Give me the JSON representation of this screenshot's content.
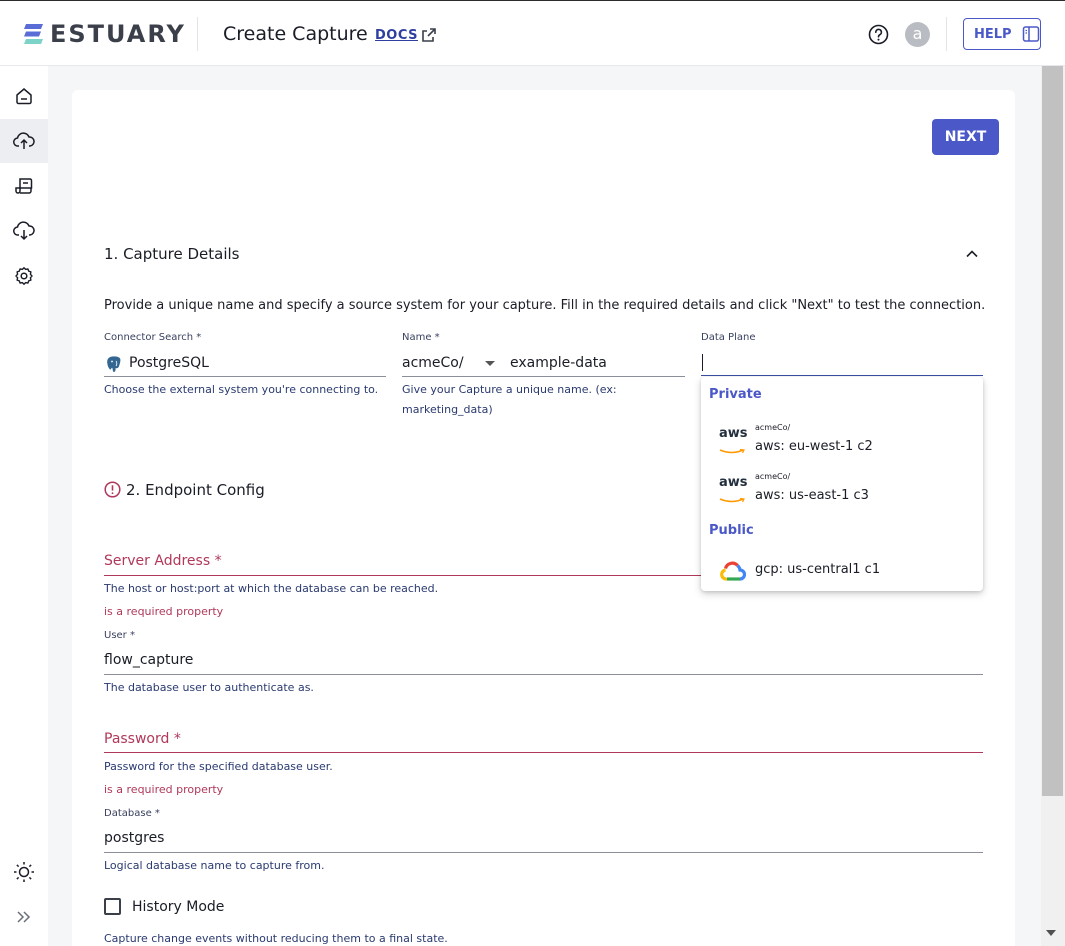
{
  "header": {
    "brand": "ESTUARY",
    "title": "Create Capture",
    "docs_label": "DOCS",
    "avatar_initial": "a",
    "help_label": "HELP"
  },
  "sidebar": {
    "items": [
      {
        "icon": "home-icon"
      },
      {
        "icon": "capture-upload-icon",
        "active": true
      },
      {
        "icon": "collections-icon"
      },
      {
        "icon": "materialize-download-icon"
      },
      {
        "icon": "gear-icon"
      }
    ],
    "bottom": [
      {
        "icon": "theme-sun-icon"
      },
      {
        "icon": "expand-double-chevron-icon"
      }
    ]
  },
  "actions": {
    "next_label": "NEXT"
  },
  "section1": {
    "title": "1. Capture Details",
    "description": "Provide a unique name and specify a source system for your capture. Fill in the required details and click \"Next\" to test the connection.",
    "connector": {
      "label": "Connector Search *",
      "value": "PostgreSQL",
      "helper": "Choose the external system you're connecting to."
    },
    "name": {
      "label": "Name *",
      "prefix": "acmeCo/",
      "value": "example-data",
      "helper_line1": "Give your Capture a unique name. (ex:",
      "helper_line2": "marketing_data)"
    },
    "data_plane": {
      "label": "Data Plane",
      "value": ""
    }
  },
  "data_plane_popup": {
    "groups": [
      {
        "label": "Private",
        "options": [
          {
            "prefix": "acmeCo/",
            "label": "aws: eu-west-1 c2",
            "provider": "aws"
          },
          {
            "prefix": "acmeCo/",
            "label": "aws: us-east-1 c3",
            "provider": "aws"
          }
        ]
      },
      {
        "label": "Public",
        "options": [
          {
            "prefix": "",
            "label": "gcp: us-central1 c1",
            "provider": "gcp"
          }
        ]
      }
    ],
    "aws_text": "aws"
  },
  "section2": {
    "title": "2. Endpoint Config",
    "server_address": {
      "label": "Server Address *",
      "helper": "The host or host:port at which the database can be reached.",
      "error": "is a required property"
    },
    "user": {
      "label": "User *",
      "value": "flow_capture",
      "helper": "The database user to authenticate as."
    },
    "password": {
      "label": "Password *",
      "helper": "Password for the specified database user.",
      "error": "is a required property"
    },
    "database": {
      "label": "Database *",
      "value": "postgres",
      "helper": "Logical database name to capture from."
    },
    "history_mode": {
      "label": "History Mode",
      "checked": false,
      "helper": "Capture change events without reducing them to a final state."
    }
  },
  "colors": {
    "primary": "#4b58c8",
    "error": "#b0385a",
    "link": "#2f3fa0"
  }
}
